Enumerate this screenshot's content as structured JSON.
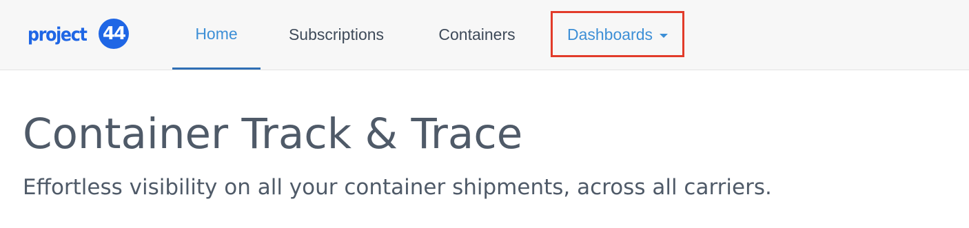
{
  "brand": {
    "name": "project",
    "badge": "44",
    "color": "#1f66e5"
  },
  "nav": {
    "items": [
      {
        "label": "Home",
        "active": true
      },
      {
        "label": "Subscriptions",
        "active": false
      },
      {
        "label": "Containers",
        "active": false
      },
      {
        "label": "Dashboards",
        "active": false,
        "has_dropdown": true
      }
    ],
    "active_color": "#3d8fd6",
    "highlight_color": "#e23b2a"
  },
  "hero": {
    "title": "Container Track & Trace",
    "subtitle": "Effortless visibility on all your container shipments, across all carriers."
  }
}
